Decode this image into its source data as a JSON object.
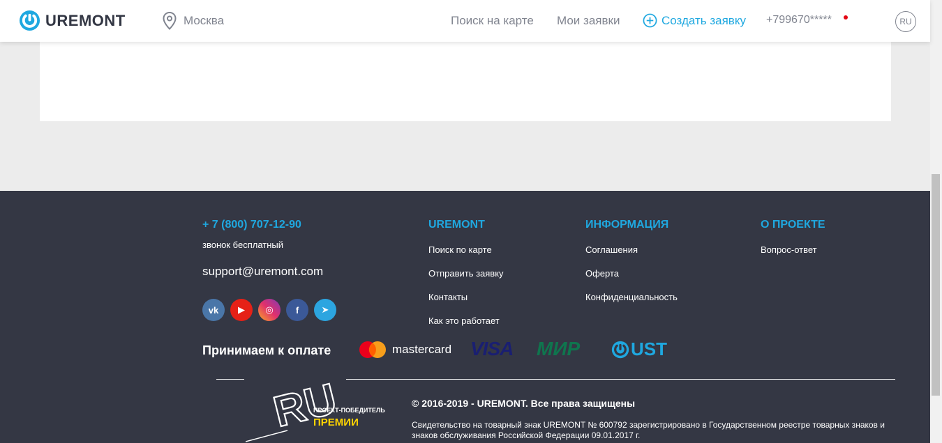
{
  "header": {
    "logo_text": "UREMONT",
    "city": "Москва",
    "nav_map": "Поиск на карте",
    "nav_orders": "Мои заявки",
    "create_label": "Создать заявку",
    "phone": "+799670*****",
    "lang": "RU"
  },
  "footer": {
    "phone": "+ 7 (800) 707-12-90",
    "phone_note": "звонок бесплатный",
    "email": "support@uremont.com",
    "socials": [
      {
        "label": "vk",
        "color": "#4a76a8"
      },
      {
        "label": "▶",
        "color": "#e62117"
      },
      {
        "label": "◎",
        "color": "#c13584"
      },
      {
        "label": "f",
        "color": "#3b5998"
      },
      {
        "label": "➤",
        "color": "#2ca5e0"
      }
    ],
    "columns": [
      {
        "title": "UREMONT",
        "links": [
          "Поиск по карте",
          "Отправить заявку",
          "Контакты",
          "Как это работает"
        ]
      },
      {
        "title": "ИНФОРМАЦИЯ",
        "links": [
          "Соглашения",
          "Оферта",
          "Конфиденциальность"
        ]
      },
      {
        "title": "О ПРОЕКТЕ",
        "links": [
          "Вопрос-ответ"
        ]
      }
    ],
    "payment_label": "Принимаем к оплате",
    "payment_methods": {
      "mastercard": "mastercard",
      "visa": "VISA",
      "mir": "МИР",
      "ust": "UST"
    },
    "badge": {
      "ru": "RU",
      "winner": "ПРОЕКТ-ПОБЕДИТЕЛЬ",
      "premium": "ПРЕМИИ"
    },
    "copyright": "© 2016-2019 - UREMONT. Все права защищены",
    "certificate": "Свидетельство на товарный знак UREMONT № 600792 зарегистрировано в Государственном реестре товарных знаков и знаков обслуживания Российской Федерации 09.01.2017 г."
  },
  "colors": {
    "accent": "#1fa8e0",
    "footer_bg": "#343744",
    "notification": "#e30613"
  }
}
